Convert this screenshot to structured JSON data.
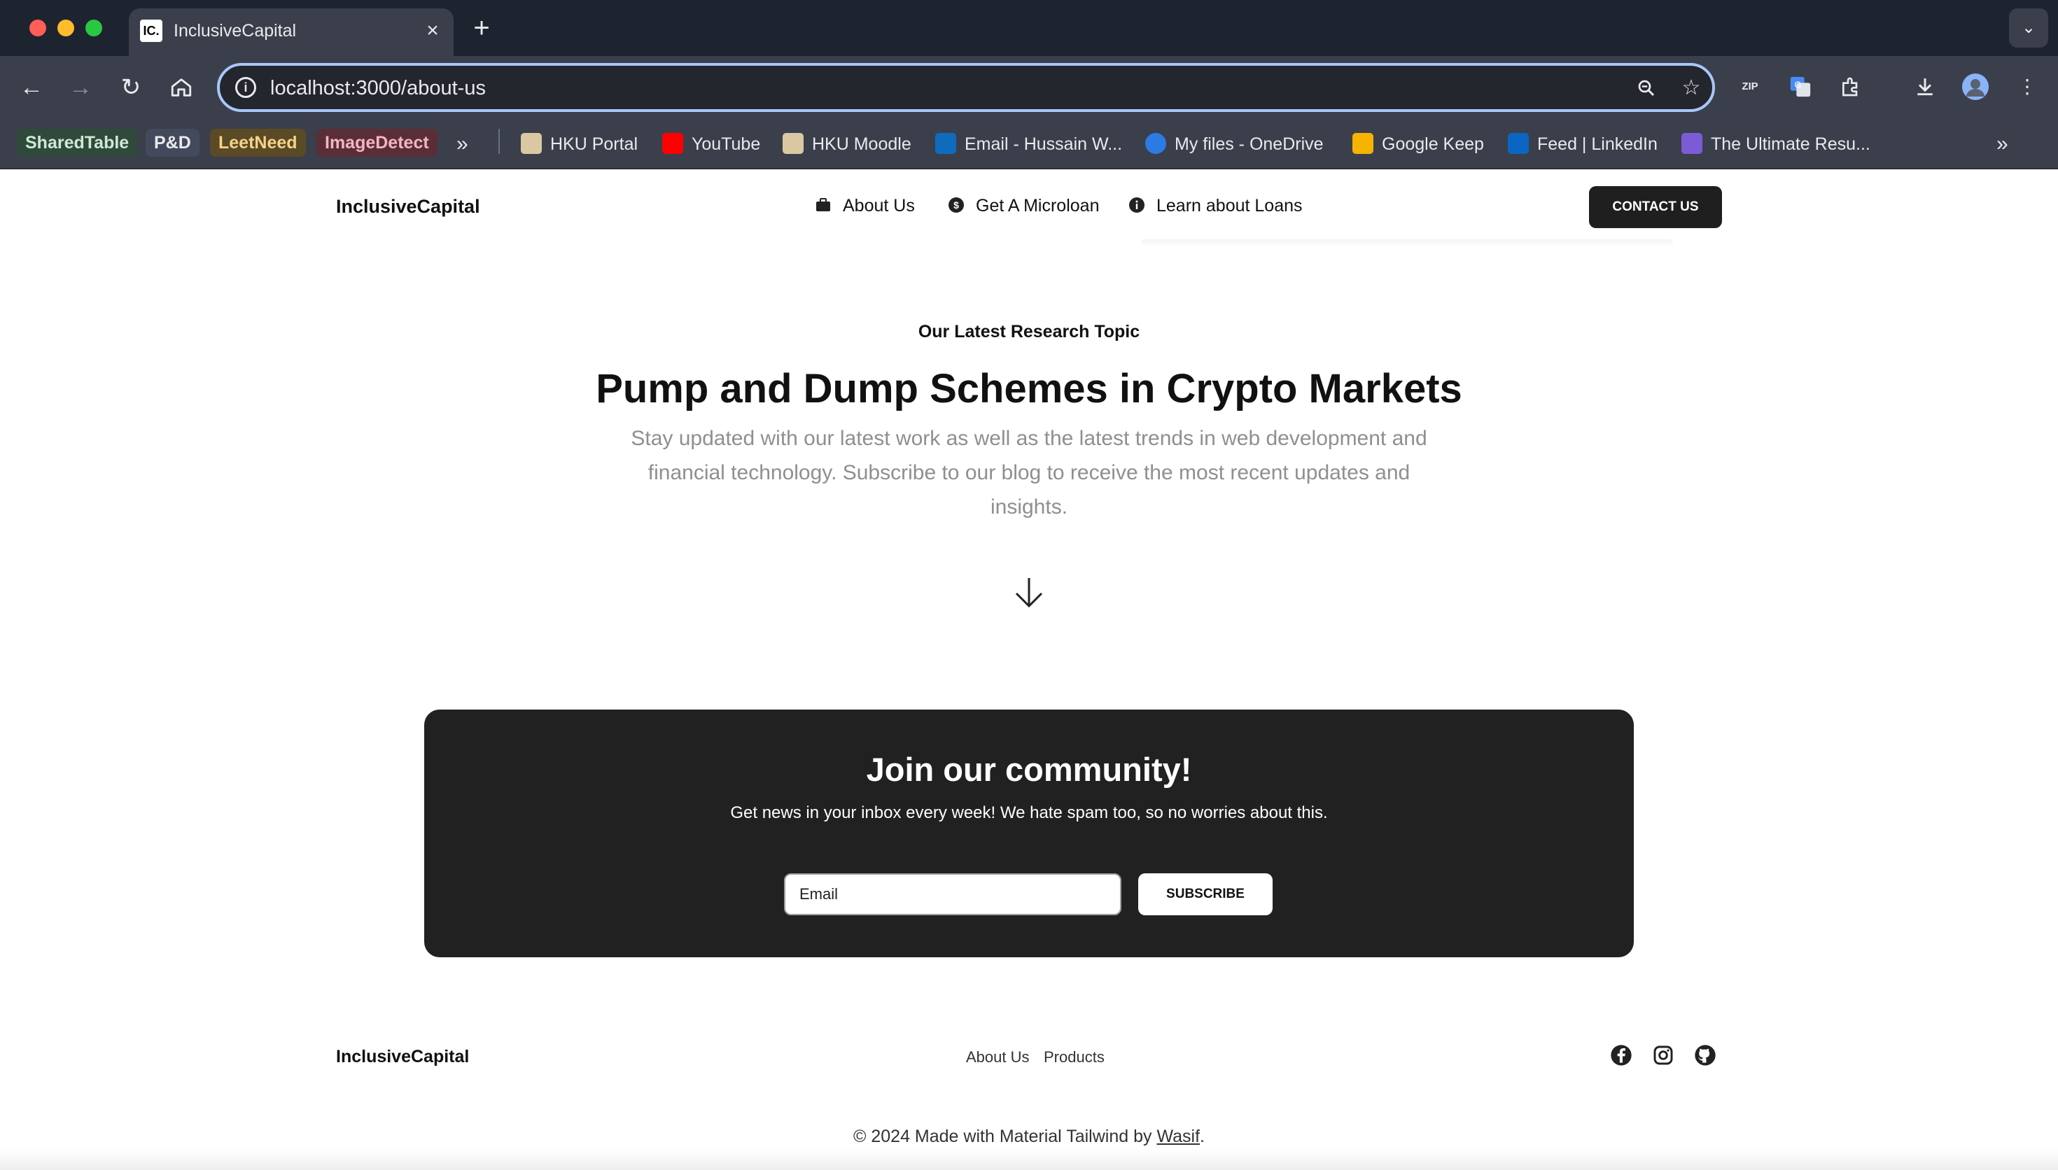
{
  "browser": {
    "tab_title": "InclusiveCapital",
    "tab_favicon_text": "IC.",
    "url": "localhost:3000/about-us",
    "bookmarks_chips": [
      {
        "label": "SharedTable",
        "color": "#2f4a3a",
        "text_color": "#cde8d4"
      },
      {
        "label": "P&D",
        "color": "#434a5c",
        "text_color": "#e8eaed"
      },
      {
        "label": "LeetNeed",
        "color": "#5a4a25",
        "text_color": "#f4d38a"
      },
      {
        "label": "ImageDetect",
        "color": "#5a2e36",
        "text_color": "#f3b6c0"
      }
    ],
    "bookmarks": [
      {
        "label": "HKU Portal",
        "icon": "hku-portal-icon",
        "color": "#d9c8a2"
      },
      {
        "label": "YouTube",
        "icon": "youtube-icon",
        "color": "#ff0000"
      },
      {
        "label": "HKU Moodle",
        "icon": "hku-moodle-icon",
        "color": "#d9c8a2"
      },
      {
        "label": "Email - Hussain W...",
        "icon": "outlook-icon",
        "color": "#0f6cbd"
      },
      {
        "label": "My files - OneDrive",
        "icon": "onedrive-icon",
        "color": "#2c7be5"
      },
      {
        "label": "Google Keep",
        "icon": "google-keep-icon",
        "color": "#f6b400"
      },
      {
        "label": "Feed | LinkedIn",
        "icon": "linkedin-icon",
        "color": "#0a66c2"
      },
      {
        "label": "The Ultimate Resu...",
        "icon": "resume-icon",
        "color": "#7b5cd6"
      }
    ]
  },
  "site": {
    "brand": "InclusiveCapital",
    "nav": {
      "about": "About Us",
      "microloan": "Get A Microloan",
      "learn": "Learn about Loans"
    },
    "contact_label": "CONTACT US",
    "hero": {
      "eyebrow": "Our Latest Research Topic",
      "title": "Pump and Dump Schemes in Crypto Markets",
      "subtitle": "Stay updated with our latest work as well as the latest trends in web development and financial technology. Subscribe to our blog to receive the most recent updates and insights."
    },
    "community": {
      "title": "Join our community!",
      "text": "Get news in your inbox every week! We hate spam too, so no worries about this.",
      "email_placeholder": "Email",
      "subscribe_label": "SUBSCRIBE"
    },
    "footer": {
      "brand": "InclusiveCapital",
      "links": [
        "About Us",
        "Products"
      ],
      "copyright_prefix": "© 2024 Made with Material Tailwind by ",
      "copyright_author": "Wasif",
      "copyright_suffix": "."
    }
  }
}
